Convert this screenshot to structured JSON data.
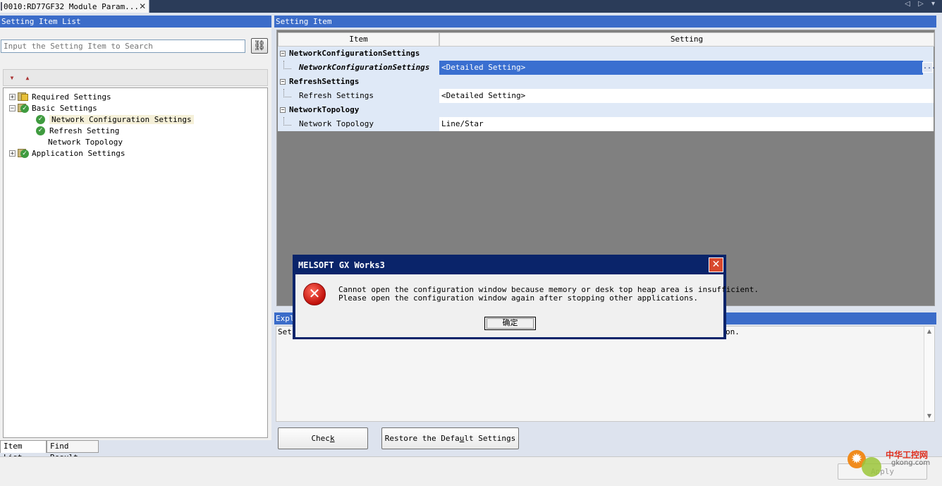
{
  "tab": {
    "title": "0010:RD77GF32 Module Param...",
    "close": "✕"
  },
  "nav": {
    "arrows": "◁ ▷ ▾"
  },
  "left": {
    "title": "Setting Item List",
    "search_placeholder": "Input the Setting Item to Search",
    "tree": [
      {
        "label": "Required Settings",
        "expander": "+",
        "status": "warning"
      },
      {
        "label": "Basic Settings",
        "expander": "−",
        "status": "ok"
      },
      {
        "label": "Network Configuration Settings",
        "status": "ok",
        "selected": true
      },
      {
        "label": "Refresh Setting",
        "status": "ok"
      },
      {
        "label": "Network Topology",
        "status": "none"
      },
      {
        "label": "Application Settings",
        "expander": "+",
        "status": "ok"
      }
    ],
    "bottom_tabs": {
      "item_list": "Item List",
      "find_result": "Find Result"
    }
  },
  "right": {
    "title": "Setting Item",
    "columns": {
      "item": "Item",
      "setting": "Setting"
    },
    "rows": [
      {
        "type": "category",
        "label": "NetworkConfigurationSettings"
      },
      {
        "type": "item",
        "label": "NetworkConfigurationSettings",
        "value": "<Detailed Setting>",
        "selected": true
      },
      {
        "type": "category",
        "label": "RefreshSettings"
      },
      {
        "type": "item",
        "label": "Refresh Settings",
        "value": "<Detailed Setting>"
      },
      {
        "type": "category",
        "label": "NetworkTopology"
      },
      {
        "type": "item",
        "label": "Network Topology",
        "value": "Line/Star"
      }
    ],
    "ellipsis": "..."
  },
  "explanation": {
    "title": "Expl",
    "text_start": "Set",
    "text_end": "on."
  },
  "buttons": {
    "check_pre": "Chec",
    "check_key": "k",
    "restore_pre": "Restore the Defa",
    "restore_key": "u",
    "restore_post": "lt Settings",
    "apply": "Apply"
  },
  "dialog": {
    "title": "MELSOFT GX Works3",
    "close": "✕",
    "line1": "Cannot open the configuration window because memory or desk top heap area is insufficient.",
    "line2": "Please open the configuration window again after stopping other applications.",
    "ok": "确定",
    "icon": "error-icon"
  },
  "watermark": {
    "cn": "中华工控网",
    "en": "gkong.com"
  }
}
